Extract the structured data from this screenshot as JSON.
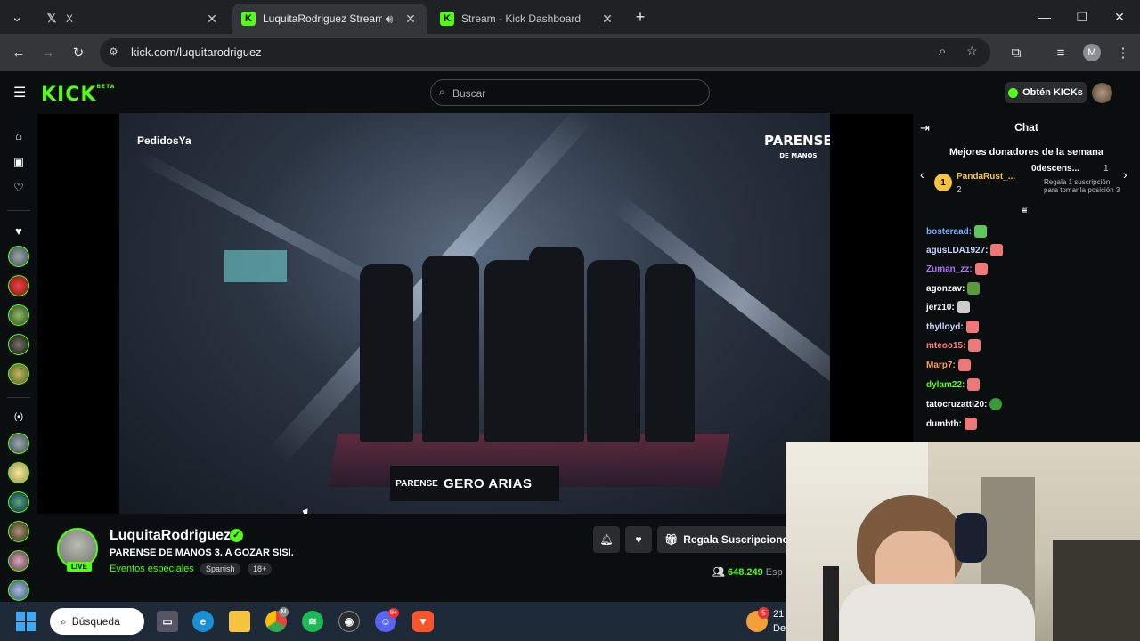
{
  "browser": {
    "tabs": [
      {
        "label": "X",
        "icon": "x-logo-icon",
        "active": false
      },
      {
        "label": "LuquitaRodriguez Stream -",
        "icon": "kick-logo-icon",
        "active": true
      },
      {
        "label": "Stream - Kick Dashboard",
        "icon": "kick-logo-icon",
        "active": false
      }
    ],
    "url": "kick.com/luquitarodriguez",
    "profile_initial": "M"
  },
  "kick": {
    "logo": "KICK",
    "logo_badge": "BETA",
    "search_placeholder": "Buscar",
    "get_kicks_label": "Obtén KICKs"
  },
  "video": {
    "sponsor": "PedidosYa",
    "brand_line1": "PARENSE",
    "brand_line2": "DE MANOS",
    "nameplate_logo": "PARENSE",
    "nameplate_name": "GERO ARIAS"
  },
  "stream": {
    "channel_name": "LuquitaRodriguez",
    "live_badge": "LIVE",
    "title": "PARENSE DE MANOS 3. A GOZAR SISI.",
    "category": "Eventos especiales",
    "tags": [
      "Spanish",
      "18+"
    ],
    "gift_label": "Regala Suscripcione",
    "viewer_count": "648.249",
    "viewer_suffix": "Esp"
  },
  "chat": {
    "title": "Chat",
    "donors_title": "Mejores donadores de la semana",
    "donors": [
      {
        "rank": "1",
        "name": "PandaRust_...",
        "count": "2"
      },
      {
        "rank": "",
        "name": "0descens...",
        "count": "1",
        "note": "Regala 1 suscripción para tomar la posición 3"
      }
    ],
    "messages": [
      {
        "user": "bosteraad:",
        "color": "#7aa6ff"
      },
      {
        "user": "agusLDA1927:",
        "color": "#c7d2ff"
      },
      {
        "user": "Zuman_zz:",
        "color": "#b06bff"
      },
      {
        "user": "agonzav:",
        "color": "#ffffff"
      },
      {
        "user": "jerz10:",
        "color": "#ffffff"
      },
      {
        "user": "thylloyd:",
        "color": "#c7d2ff"
      },
      {
        "user": "mteoo15:",
        "color": "#ff7a7a"
      },
      {
        "user": "Marp7:",
        "color": "#ff9a5a"
      },
      {
        "user": "dylam22:",
        "color": "#53fc18"
      },
      {
        "user": "tatocruzatti20:",
        "color": "#ffffff"
      },
      {
        "user": "dumbth:",
        "color": "#ffffff"
      }
    ]
  },
  "taskbar": {
    "search_label": "Búsqueda",
    "clock_partial": "21",
    "clock_sub": "De",
    "badges": {
      "chrome": "M",
      "discord": "9+",
      "notif": "5"
    }
  },
  "colors": {
    "accent": "#53fc18",
    "background": "#0b0e0f",
    "browser_chrome": "#202124"
  }
}
